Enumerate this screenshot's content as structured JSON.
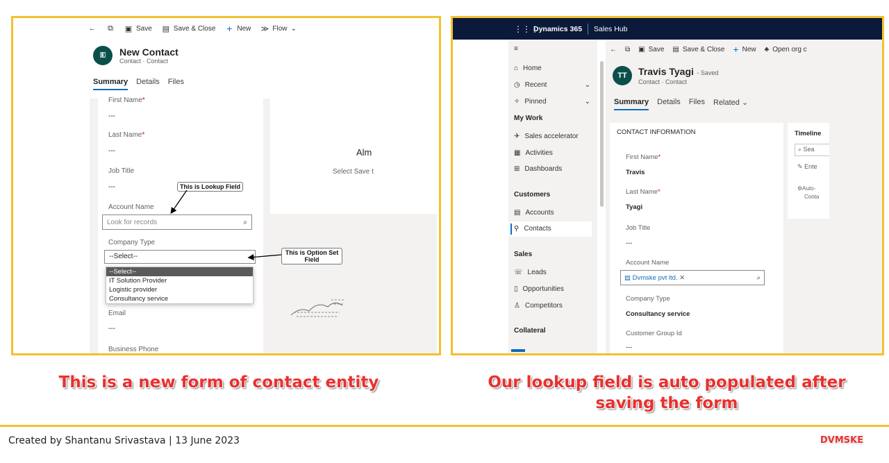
{
  "left": {
    "toolbar": {
      "back": "←",
      "save": "Save",
      "save_close": "Save & Close",
      "new": "New",
      "flow": "Flow"
    },
    "header": {
      "avatar": "🗉",
      "title": "New Contact",
      "subtitle": "Contact · Contact"
    },
    "tabs": [
      "Summary",
      "Details",
      "Files"
    ],
    "fields": {
      "first_name": {
        "label": "First Name",
        "value": "---"
      },
      "last_name": {
        "label": "Last Name",
        "value": "---"
      },
      "job_title": {
        "label": "Job Title",
        "value": "---"
      },
      "account_name": {
        "label": "Account Name",
        "placeholder": "Look for records"
      },
      "company_type": {
        "label": "Company Type",
        "value": "--Select--"
      },
      "email": {
        "label": "Email",
        "value": "---"
      },
      "business_phone": {
        "label": "Business Phone"
      }
    },
    "dropdown_options": [
      "--Select--",
      "IT Solution Provider",
      "Logistic provider",
      "Consultancy service"
    ],
    "side_text": {
      "heading": "Alm",
      "body": "Select Save t"
    },
    "callouts": {
      "lookup": "This is Lookup Field",
      "optionset": "This is Option Set Field"
    }
  },
  "right": {
    "topnav": {
      "brand": "Dynamics 365",
      "app": "Sales Hub"
    },
    "sidebar": {
      "items": [
        "Home",
        "Recent",
        "Pinned"
      ],
      "groups": [
        "My Work",
        "Customers",
        "Sales",
        "Collateral"
      ],
      "my_work": [
        "Sales accelerator",
        "Activities",
        "Dashboards"
      ],
      "customers": [
        "Accounts",
        "Contacts"
      ],
      "sales": [
        "Leads",
        "Opportunities",
        "Competitors"
      ]
    },
    "toolbar": {
      "save": "Save",
      "save_close": "Save & Close",
      "new": "New",
      "open_org": "Open org c"
    },
    "header": {
      "initials": "TT",
      "name": "Travis Tyagi",
      "status": "- Saved",
      "subtitle": "Contact · Contact"
    },
    "tabs": [
      "Summary",
      "Details",
      "Files",
      "Related"
    ],
    "section_title": "CONTACT INFORMATION",
    "fields": {
      "first_name": {
        "label": "First Name",
        "value": "Travis"
      },
      "last_name": {
        "label": "Last Name",
        "value": "Tyagi"
      },
      "job_title": {
        "label": "Job Title",
        "value": "---"
      },
      "account_name": {
        "label": "Account Name",
        "value": "Dvmske pvt ltd."
      },
      "company_type": {
        "label": "Company Type",
        "value": "Consultancy service"
      },
      "customer_group": {
        "label": "Customer Group Id",
        "value": "---"
      }
    },
    "timeline": {
      "title": "Timeline",
      "search": "Sea",
      "enter": "Ente",
      "auto": "Auto-",
      "conta": "Conta"
    }
  },
  "captions": {
    "left": "This is a new form of contact entity",
    "right": "Our lookup field is auto populated after saving the form"
  },
  "footer": {
    "credit": "Created by Shantanu Srivastava  |  13 June 2023",
    "logo": "DVMSKE"
  }
}
